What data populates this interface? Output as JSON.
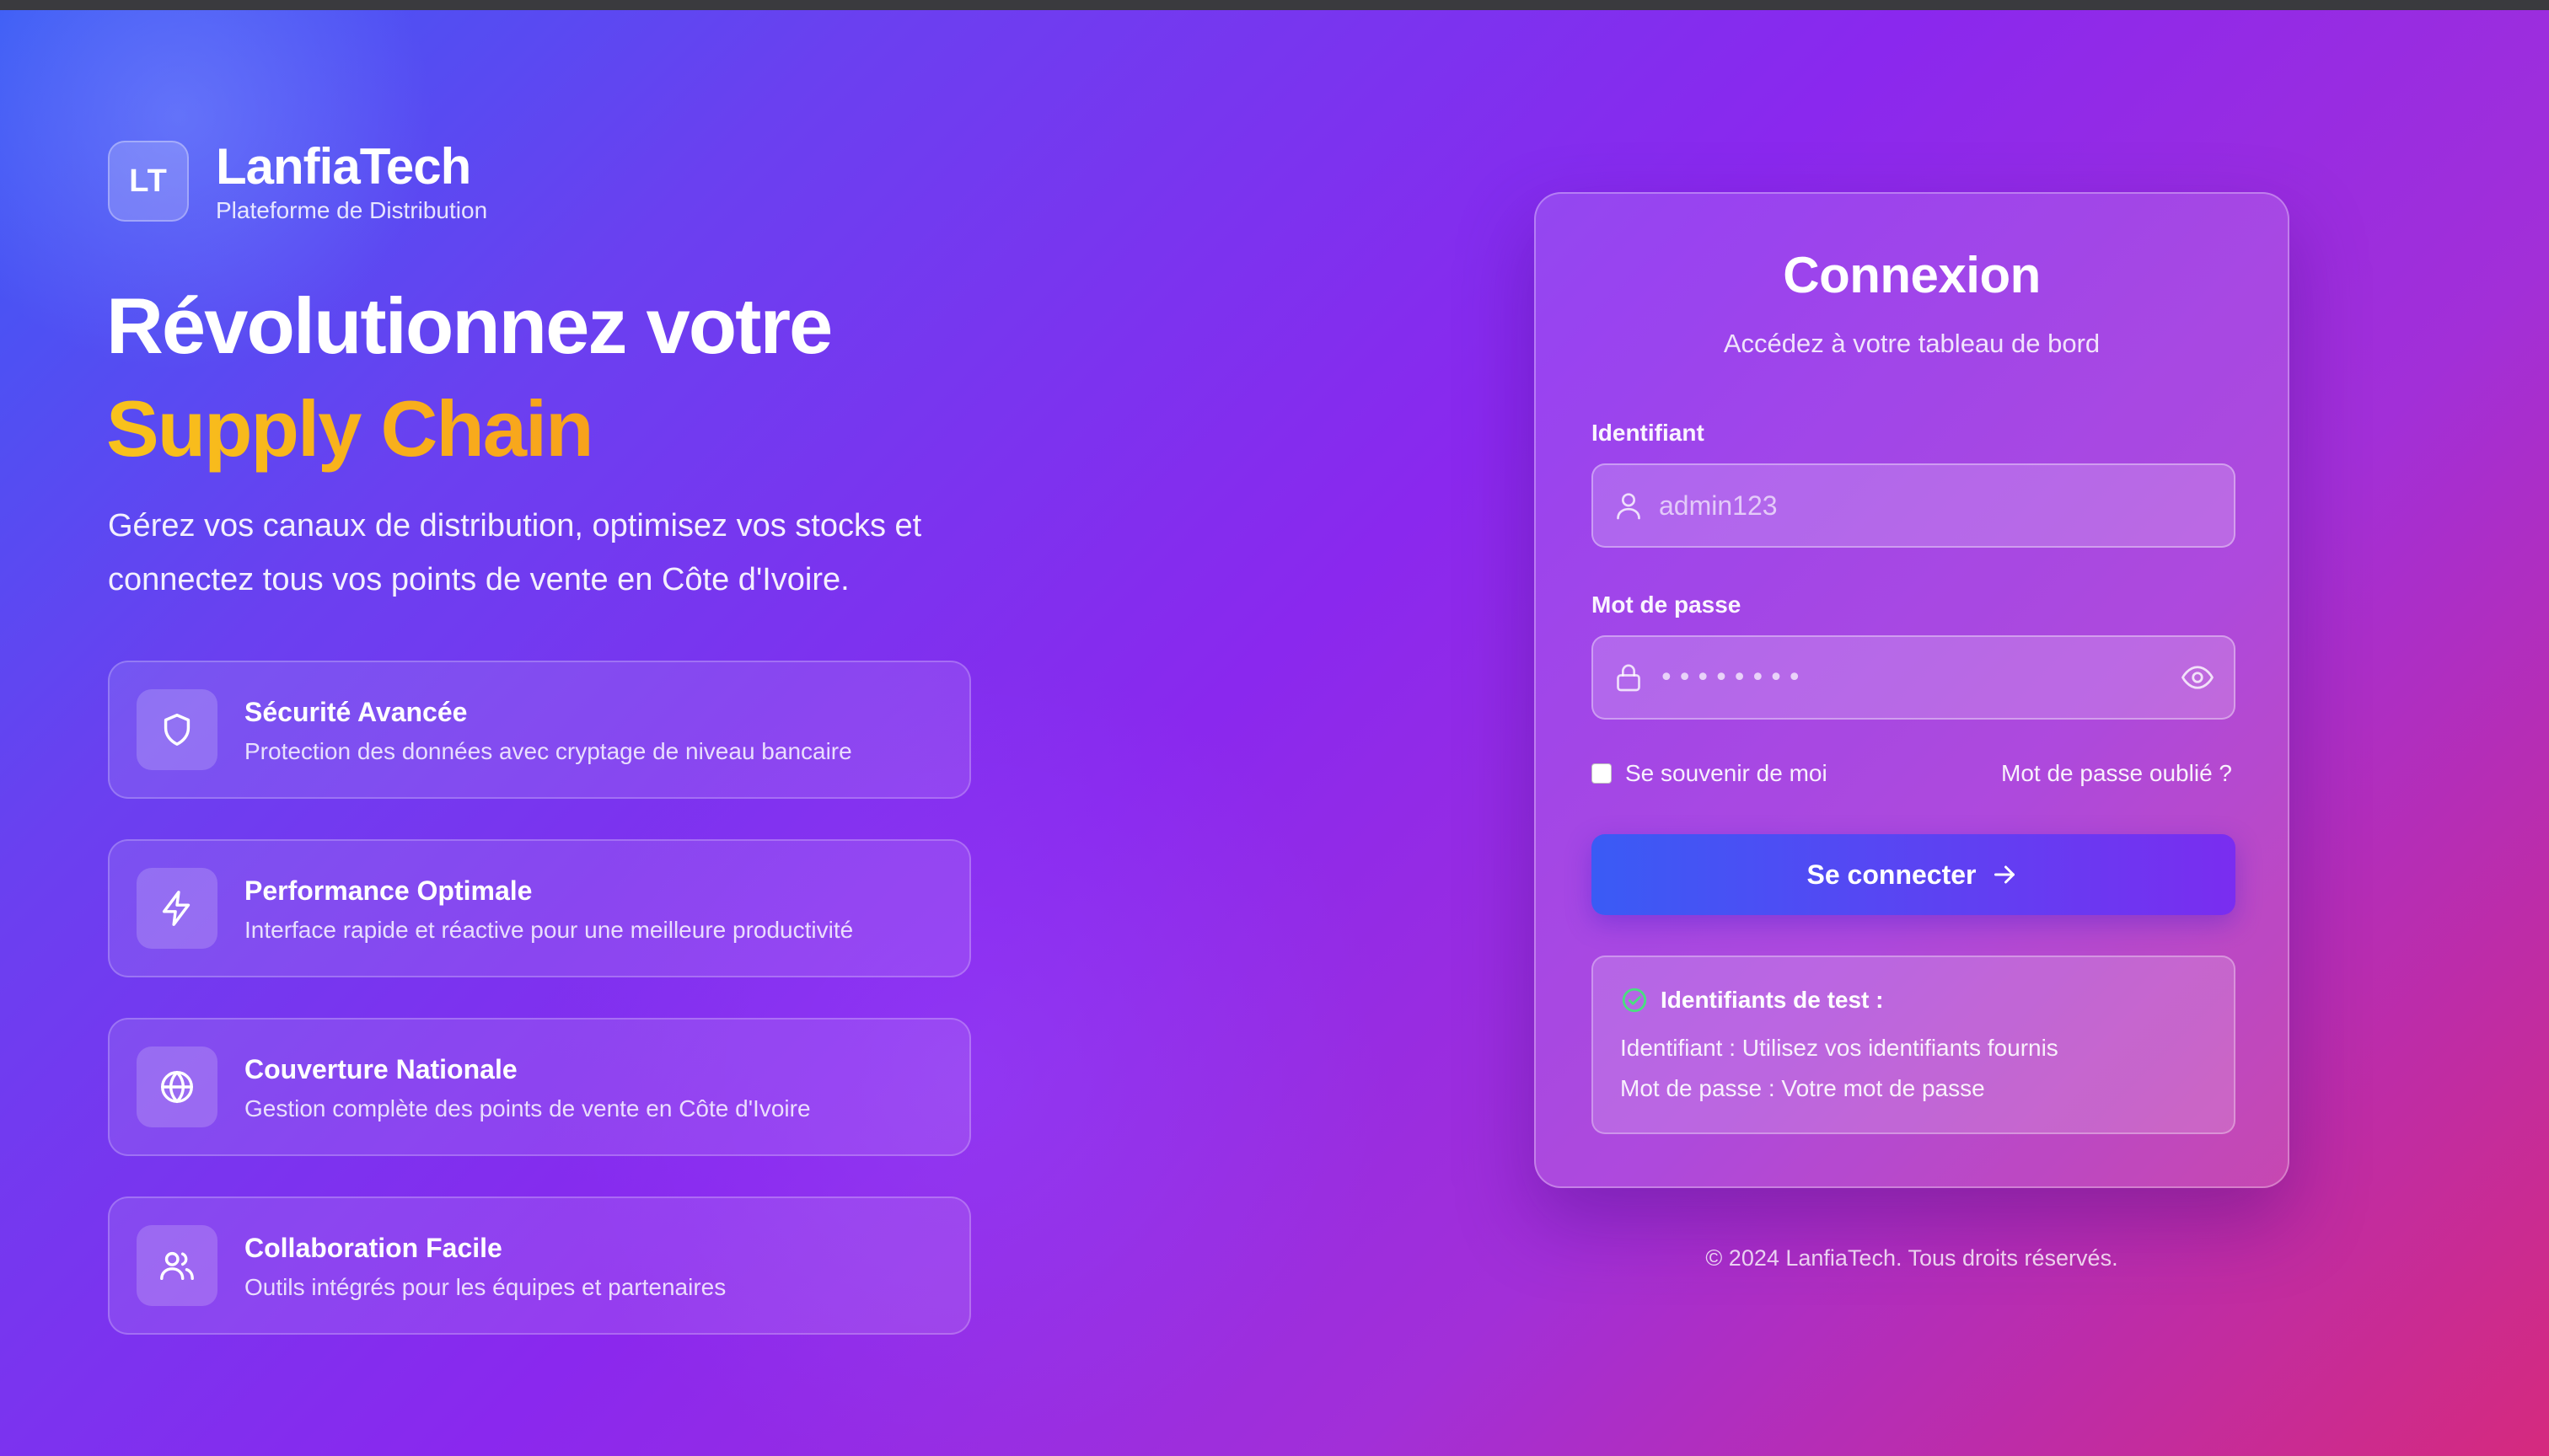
{
  "brand": {
    "logo_text": "LT",
    "name": "LanfiaTech",
    "tagline": "Plateforme de Distribution"
  },
  "hero": {
    "title_line1": "Révolutionnez votre",
    "title_accent": "Supply Chain",
    "description": "Gérez vos canaux de distribution, optimisez vos stocks et connectez tous vos points de vente en Côte d'Ivoire.",
    "accent_colors": [
      "#f8c21c",
      "#f7921c"
    ]
  },
  "features": [
    {
      "icon": "shield-icon",
      "title": "Sécurité Avancée",
      "text": "Protection des données avec cryptage de niveau bancaire"
    },
    {
      "icon": "lightning-icon",
      "title": "Performance Optimale",
      "text": "Interface rapide et réactive pour une meilleure productivité"
    },
    {
      "icon": "globe-icon",
      "title": "Couverture Nationale",
      "text": "Gestion complète des points de vente en Côte d'Ivoire"
    },
    {
      "icon": "users-icon",
      "title": "Collaboration Facile",
      "text": "Outils intégrés pour les équipes et partenaires"
    }
  ],
  "login": {
    "title": "Connexion",
    "subtitle": "Accédez à votre tableau de bord",
    "username_label": "Identifiant",
    "username_placeholder": "admin123",
    "password_label": "Mot de passe",
    "password_mask": "••••••••",
    "remember_label": "Se souvenir de moi",
    "forgot_label": "Mot de passe oublié ?",
    "submit_label": "Se connecter",
    "test_title": "Identifiants de test :",
    "test_line1": "Identifiant : Utilisez vos identifiants fournis",
    "test_line2": "Mot de passe : Votre mot de passe"
  },
  "footer": "© 2024 LanfiaTech. Tous droits réservés.",
  "colors": {
    "button_start": "#3a5bf5",
    "button_end": "#7a2df0",
    "check_green": "#4ade80"
  }
}
